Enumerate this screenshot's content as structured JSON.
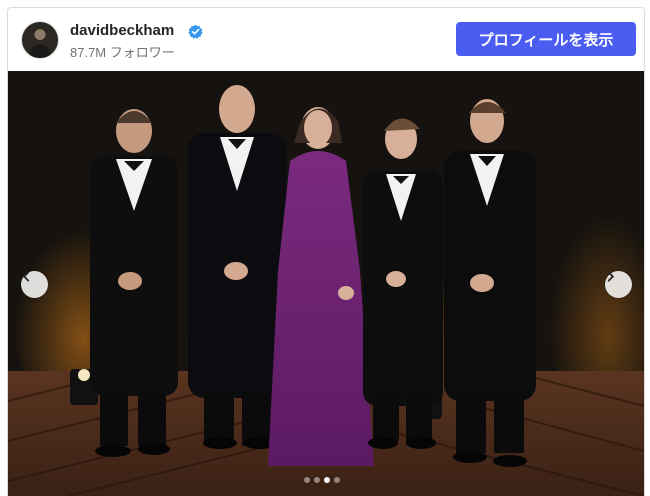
{
  "post": {
    "username": "davidbeckham",
    "followers": "87.7M フォロワー",
    "profile_button_label": "プロフィールを表示",
    "verified": true
  },
  "carousel": {
    "slide_count": 4,
    "active_index": 2,
    "prev_icon": "chevron-left-icon",
    "next_icon": "chevron-right-icon"
  },
  "colors": {
    "accent": "#4a5df0",
    "verified": "#3897f0"
  }
}
